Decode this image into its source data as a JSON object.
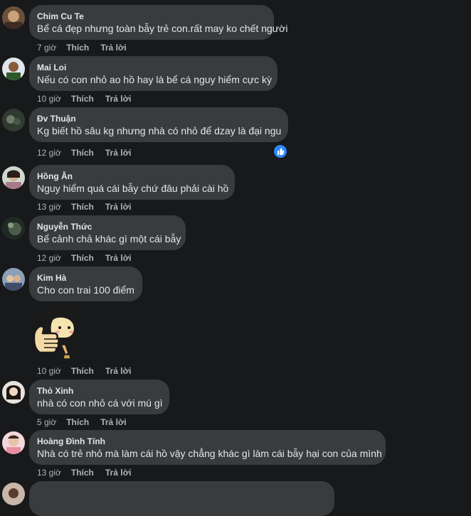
{
  "comments": [
    {
      "author": "Chim Cu Te",
      "text": "Bể cá đẹp nhưng toàn bẫy trẻ con.rất may ko chết người",
      "time": "7 giờ",
      "like": "Thích",
      "reply": "Trả lời"
    },
    {
      "author": "Mai Loi",
      "text": "Nếu có con nhỏ ao hồ hay là bể cá nguy hiểm cực kỳ",
      "time": "10 giờ",
      "like": "Thích",
      "reply": "Trả lời"
    },
    {
      "author": "Đv Thuận",
      "text": "Kg biết hồ sâu kg nhưng nhà có nhỏ để dzay là đại ngu",
      "time": "12 giờ",
      "like": "Thích",
      "reply": "Trả lời"
    },
    {
      "author": "Hồng Ân",
      "text": "Nguy hiểm quá cái bẫy chứ đâu phải cài hồ",
      "time": "13 giờ",
      "like": "Thích",
      "reply": "Trả lời"
    },
    {
      "author": "Nguyễn Thức",
      "text": "Bể cảnh chả khác gì một cái bẫy",
      "time": "12 giờ",
      "like": "Thích",
      "reply": "Trả lời"
    },
    {
      "author": "Kim Hà",
      "text": "Cho con trai 100 điểm",
      "time": "10 giờ",
      "like": "Thích",
      "reply": "Trả lời"
    },
    {
      "author": "Thỏ Xinh",
      "text": "nhà có con nhỏ cá với mú gì",
      "time": "5 giờ",
      "like": "Thích",
      "reply": "Trả lời"
    },
    {
      "author": "Hoàng Đình Tính",
      "text": "Nhà có trẻ nhỏ mà làm cái hồ vậy chẳng khác gì làm cái bẫy hại con của mình",
      "time": "13 giờ",
      "like": "Thích",
      "reply": "Trả lời"
    }
  ],
  "colors": {
    "background": "#18191a",
    "bubble": "#3a3b3c",
    "text": "#e4e6eb",
    "secondary": "#b0b3b8",
    "like_blue": "#2d88ff"
  },
  "icons": {
    "reaction": "like-thumb-icon",
    "sticker": "thumbs-up-girl-sticker"
  }
}
